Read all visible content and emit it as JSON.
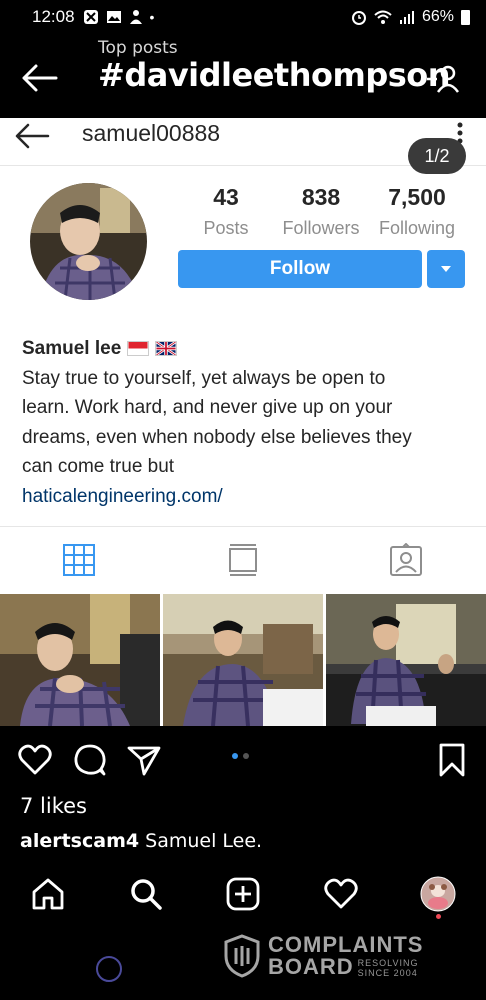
{
  "status_bar": {
    "time": "12:08",
    "battery": "66%"
  },
  "outer_header": {
    "subtitle": "Top posts",
    "hashtag": "#davidleethompson"
  },
  "profile": {
    "username": "samuel00888",
    "counter": "1/2",
    "stats": [
      {
        "num": "43",
        "label": "Posts"
      },
      {
        "num": "838",
        "label": "Followers"
      },
      {
        "num": "7,500",
        "label": "Following"
      }
    ],
    "follow_label": "Follow",
    "display_name": "Samuel lee",
    "bio_lines": [
      "Stay true to yourself, yet always be open to",
      "learn. Work hard, and never give up on your",
      "dreams, even when nobody else believes they",
      "can come true but"
    ],
    "link": "haticalengineering.com/"
  },
  "post": {
    "likes": "7 likes",
    "caption_user": "alertscam4",
    "caption_text": " Samuel Lee."
  },
  "watermark": {
    "line1": "COMPLAINTS",
    "line2": "BOARD",
    "sub1": "RESOLVING",
    "sub2": "SINCE 2004"
  },
  "colors": {
    "accent_blue": "#3897f0",
    "link": "#003569",
    "notification": "#ed4956"
  }
}
